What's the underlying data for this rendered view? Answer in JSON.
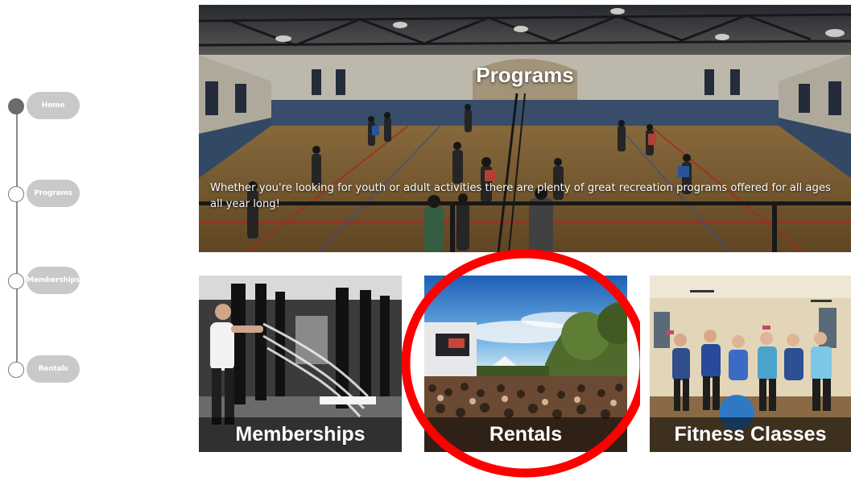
{
  "nav": {
    "items": [
      {
        "label": "Home",
        "active": true
      },
      {
        "label": "Programs",
        "active": false
      },
      {
        "label": "Memberships",
        "active": false
      },
      {
        "label": "Rentals",
        "active": false
      }
    ]
  },
  "hero": {
    "title": "Programs",
    "description": "Whether you're looking for youth or adult activities there are plenty of great recreation programs offered for all ages all year long!"
  },
  "tiles": [
    {
      "label": "Memberships"
    },
    {
      "label": "Rentals"
    },
    {
      "label": "Fitness Classes"
    }
  ],
  "colors": {
    "annotation": "#ff0000",
    "nav_pill": "#c9c9c9",
    "nav_active": "#6b6b6b"
  }
}
